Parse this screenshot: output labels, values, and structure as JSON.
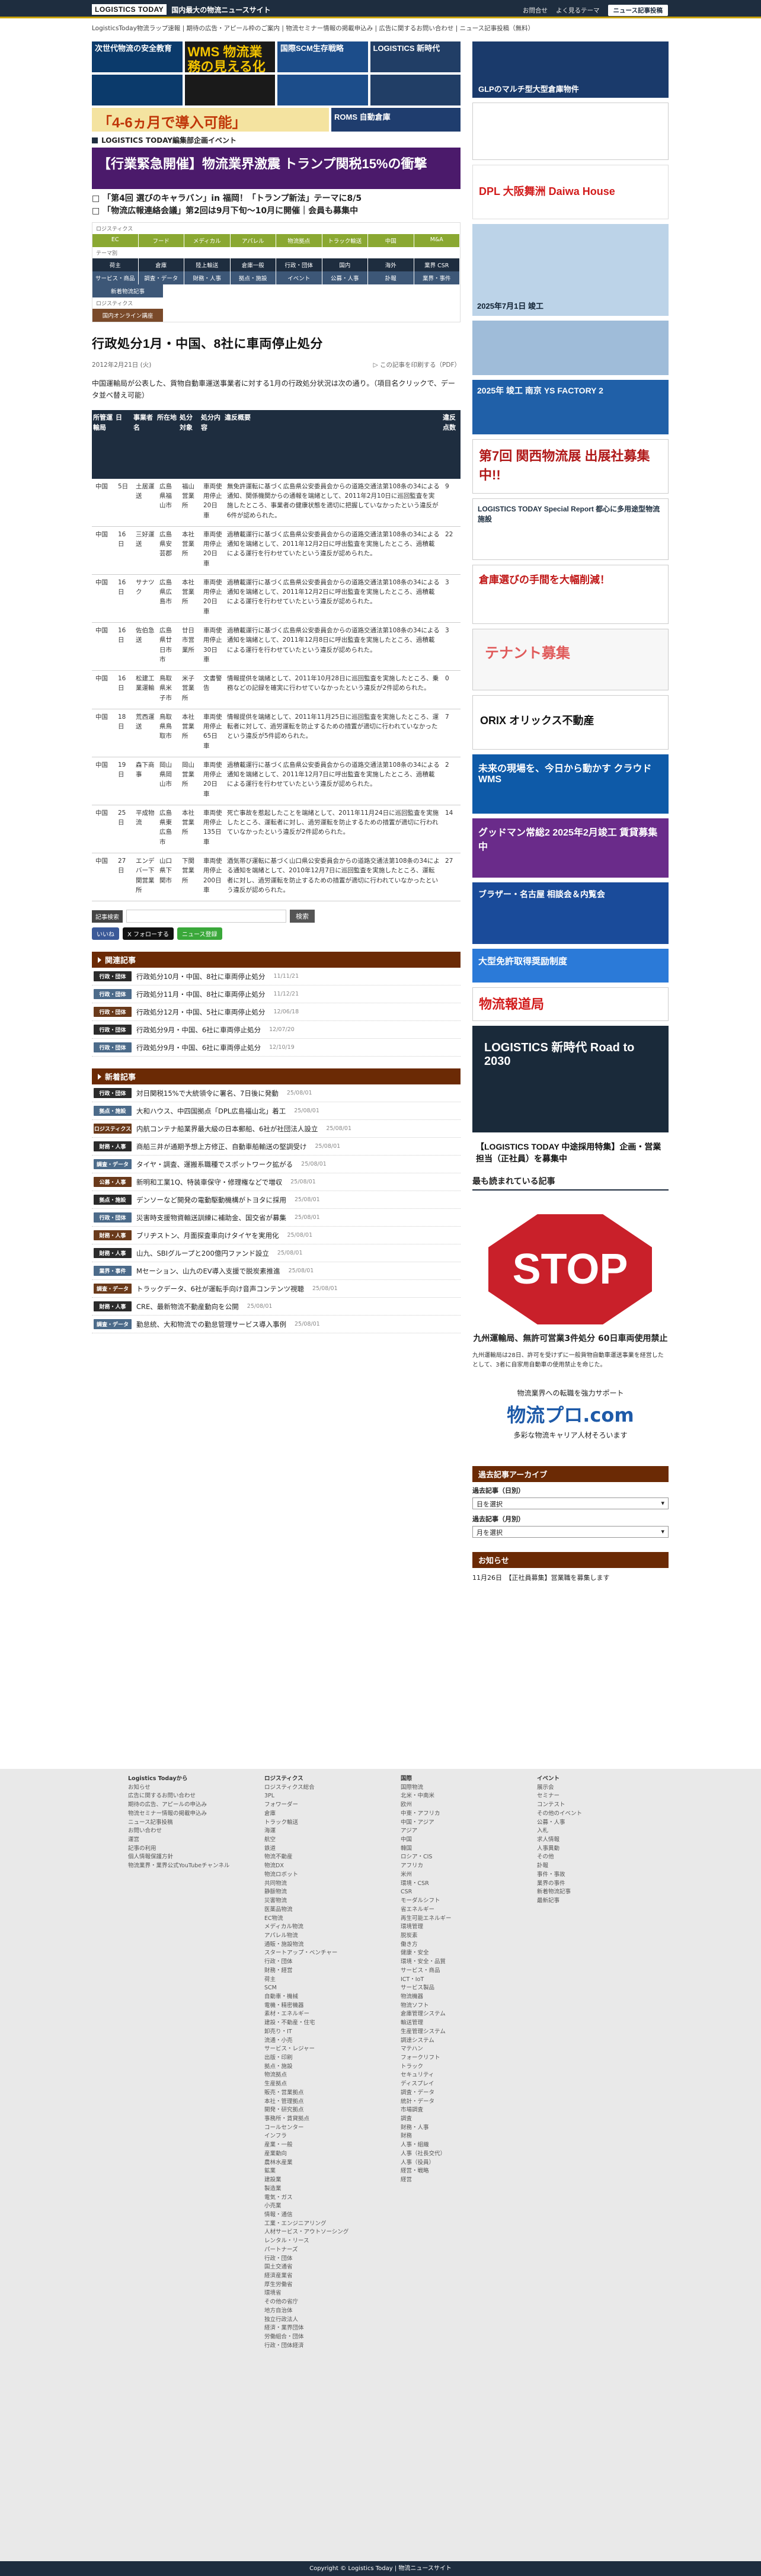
{
  "header": {
    "logo_text": "LOGISTICS TODAY",
    "logo_sub": "国内最大の物流ニュースサイト",
    "links": [
      "お問合せ",
      "よく見るテーマ"
    ],
    "news_btn": "ニュース記事投稿"
  },
  "ticker": "LogisticsToday物流ラップ速報 | 期待の広告・アピール枠のご案内 | 物流セミナー情報の掲載申込み | 広告に関するお問い合わせ | ニュース記事投稿（無料）",
  "banners": {
    "top": [
      "次世代物流の安全教育",
      "WMS 物流業務の見える化",
      "国際SCM生存戦略",
      "LOGISTICS 新時代"
    ],
    "roms": "「4-6ヵ月で導入可能」",
    "rollbar": "ROMS 自動倉庫",
    "event_label": "LOGISTICS TODAY編集部企画イベント",
    "promo": "【行業緊急開催】物流業界激震 トランプ関税15%の衝撃",
    "headlines": [
      "「第4回 選びのキャラバン」in 福岡！「トランプ新法」テーマに8/5",
      "「物流広報連絡会議」第2回は9月下旬〜10月に開催｜会員も募集中"
    ]
  },
  "categories": {
    "head1": "ロジスティクス",
    "row1": [
      "EC",
      "フード",
      "メディカル",
      "アパレル",
      "物流拠点",
      "トラック輸送",
      "中国",
      "M&A"
    ],
    "head2": "テーマ別",
    "row2": [
      "荷主",
      "倉庫",
      "陸上輸送",
      "倉庫一般",
      "行政・団体",
      "国内",
      "海外",
      "業界 CSR"
    ],
    "row3": [
      "サービス・商品",
      "調査・データ",
      "財務・人事",
      "拠点・施設",
      "イベント",
      "公募・人事",
      "訃報",
      "業界・事件"
    ],
    "row4": [
      "新着物流記事"
    ],
    "head3": "ロジスティクス",
    "row5": [
      "国内オンライン講座"
    ]
  },
  "article": {
    "title": "行政処分1月・中国、8社に車両停止処分",
    "date": "2012年2月21日 (火)",
    "print": "この記事を印刷する（PDF）",
    "body": "中国運輸局が公表した、貨物自動車運送事業者に対する1月の行政処分状況は次の通り。（項目名クリックで、データ並べ替え可能）",
    "columns": [
      "所管運輸局",
      "日",
      "事業者名",
      "所在地",
      "処分対象",
      "処分内容",
      "違反概要",
      "違反点数"
    ],
    "rows": [
      {
        "region": "中国",
        "day": "5日",
        "company": "土居運送",
        "location": "広島県福山市",
        "target": "福山営業所",
        "action": "車両使用停止20日車",
        "summary": "無免許運転に基づく広島県公安委員会からの道路交通法第108条の34による通知、関係機関からの通報を端緒として、2011年2月10日に巡回監査を実施したところ、事業者の健康状態を適切に把握していなかったという違反が6件が認められた。",
        "points": "9"
      },
      {
        "region": "中国",
        "day": "16日",
        "company": "三好運送",
        "location": "広島県安芸郡",
        "target": "本社営業所",
        "action": "車両使用停止20日車",
        "summary": "過積載運行に基づく広島県公安委員会からの道路交通法第108条の34による通知を端緒として、2011年12月2日に呼出監査を実施したところ、過積載による運行を行わせていたという違反が認められた。",
        "points": "22"
      },
      {
        "region": "中国",
        "day": "16日",
        "company": "サナツク",
        "location": "広島県広島市",
        "target": "本社営業所",
        "action": "車両使用停止20日車",
        "summary": "過積載運行に基づく広島県公安委員会からの道路交通法第108条の34による通知を端緒として、2011年12月2日に呼出監査を実施したところ、過積載による運行を行わせていたという違反が認められた。",
        "points": "3"
      },
      {
        "region": "中国",
        "day": "16日",
        "company": "佐伯急送",
        "location": "広島県廿日市市",
        "target": "廿日市営業所",
        "action": "車両使用停止30日車",
        "summary": "過積載運行に基づく広島県公安委員会からの道路交通法第108条の34による通知を端緒として、2011年12月8日に呼出監査を実施したところ、過積載による運行を行わせていたという違反が認められた。",
        "points": "3"
      },
      {
        "region": "中国",
        "day": "16日",
        "company": "松建工業運輸",
        "location": "鳥取県米子市",
        "target": "米子営業所",
        "action": "文書警告",
        "summary": "情報提供を端緒として、2011年10月28日に巡回監査を実施したところ、乗務などの記録を確実に行わせていなかったという違反が2件認められた。",
        "points": "0"
      },
      {
        "region": "中国",
        "day": "18日",
        "company": "荒西運送",
        "location": "鳥取県鳥取市",
        "target": "本社営業所",
        "action": "車両使用停止65日車",
        "summary": "情報提供を端緒として、2011年11月25日に巡回監査を実施したところ、運転者に対して、過労運転を防止するための措置が適切に行われていなかったという違反が5件認められた。",
        "points": "7"
      },
      {
        "region": "中国",
        "day": "19日",
        "company": "森下商事",
        "location": "岡山県岡山市",
        "target": "岡山営業所",
        "action": "車両使用停止20日車",
        "summary": "過積載運行に基づく広島県公安委員会からの道路交通法第108条の34による通知を端緒として、2011年12月7日に呼出監査を実施したところ、過積載による運行を行わせていたという違反が認められた。",
        "points": "2"
      },
      {
        "region": "中国",
        "day": "25日",
        "company": "平成物流",
        "location": "広島県東広島市",
        "target": "本社営業所",
        "action": "車両使用停止135日車",
        "summary": "死亡事故を惹起したことを端緒として、2011年11月24日に巡回監査を実施したところ、運転者に対し、過労運転を防止するための措置が適切に行われていなかったという違反が2件認められた。",
        "points": "14"
      },
      {
        "region": "中国",
        "day": "27日",
        "company": "エンデバー下関営業所",
        "location": "山口県下関市",
        "target": "下関営業所",
        "action": "車両使用停止200日車",
        "summary": "酒気帯び運転に基づく山口県公安委員会からの道路交通法第108条の34による通知を端緒として、2010年12月7日に巡回監査を実施したところ、運転者に対し、過労運転を防止するための措置が適切に行われていなかったという違反が認められた。",
        "points": "27"
      }
    ]
  },
  "search": {
    "label": "記事検索",
    "placeholder": "",
    "button": "検索"
  },
  "share": [
    "いいね",
    "X フォローする",
    "ニュース登録"
  ],
  "related": {
    "heading": "関連記事",
    "items": [
      {
        "tag": "行政・団体",
        "title": "行政処分10月・中国、8社に車両停止処分",
        "date": "11/11/21"
      },
      {
        "tag": "行政・団体",
        "title": "行政処分11月・中国、8社に車両停止処分",
        "date": "11/12/21"
      },
      {
        "tag": "行政・団体",
        "title": "行政処分12月・中国、5社に車両停止処分",
        "date": "12/06/18"
      },
      {
        "tag": "行政・団体",
        "title": "行政処分9月・中国、6社に車両停止処分",
        "date": "12/07/20"
      },
      {
        "tag": "行政・団体",
        "title": "行政処分9月・中国、6社に車両停止処分",
        "date": "12/10/19"
      }
    ]
  },
  "latest": {
    "heading": "新着記事",
    "items": [
      {
        "tag": "行政・団体",
        "title": "対日関税15%で大統領令に署名、7日後に発動",
        "date": "25/08/01"
      },
      {
        "tag": "拠点・施設",
        "title": "大和ハウス、中四国拠点「DPL広島福山北」着工",
        "date": "25/08/01"
      },
      {
        "tag": "ロジスティクス",
        "title": "内航コンテナ船業界最大級の日本郵船、6社が社団法人設立",
        "date": "25/08/01"
      },
      {
        "tag": "財務・人事",
        "title": "商船三井が通期予想上方修正、自動車船輸送の堅調受け",
        "date": "25/08/01"
      },
      {
        "tag": "調査・データ",
        "title": "タイヤ・調査、運搬系職種でスポットワーク拡がる",
        "date": "25/08/01"
      },
      {
        "tag": "公募・人事",
        "title": "新明和工業1Q、特装車保守・修理権などで増収",
        "date": "25/08/01"
      },
      {
        "tag": "拠点・施設",
        "title": "デンソーなど開発の電動駆動機構がトヨタに採用",
        "date": "25/08/01"
      },
      {
        "tag": "行政・団体",
        "title": "災害時支援物資輸送訓練に補助金、国交省が募集",
        "date": "25/08/01"
      },
      {
        "tag": "財務・人事",
        "title": "ブリヂストン、月面探査車向けタイヤを実用化",
        "date": "25/08/01"
      },
      {
        "tag": "財務・人事",
        "title": "山九、SBIグループと200億円ファンド設立",
        "date": "25/08/01"
      },
      {
        "tag": "業界・事件",
        "title": "Mセーション、山九のEV導入支援で脱炭素推進",
        "date": "25/08/01"
      },
      {
        "tag": "調査・データ",
        "title": "トラックデータ、6社が運転手向け音声コンテンツ視聴",
        "date": "25/08/01"
      },
      {
        "tag": "財務・人事",
        "title": "CRE、最新物流不動産動向を公開",
        "date": "25/08/01"
      },
      {
        "tag": "調査・データ",
        "title": "勤怠統、大和物流での勤怠管理サービス導入事例",
        "date": "25/08/01"
      }
    ]
  },
  "sidebar": {
    "banners": [
      "GLPのマルチ型大型倉庫物件",
      "DPL 大阪舞洲 Daiwa House",
      "2025年7月1日 竣工",
      "2025年 竣工 南京 YS FACTORY 2",
      "第7回 関西物流展 出展社募集中!!",
      "LOGISTICS TODAY Special Report 都心に多用途型物流施設",
      "倉庫選びの手間を大幅削減！",
      "テナント募集",
      "ORIX オリックス不動産",
      "未来の現場を、今日から動かす クラウドWMS",
      "グッドマン常総2 2025年2月竣工 賃貸募集中",
      "ブラザー・名古屋 相談会＆内覧会",
      "大型免許取得奨励制度",
      "物流報道局",
      "LOGISTICS 新時代 Road to 2030",
      "【LOGISTICS TODAY 中途採用特集】企画・営業担当（正社員）を募集中"
    ],
    "most_read": "最も読まれている記事",
    "stop_text": "STOP",
    "stop_caption": "九州運輸局、無許可営業3件処分 60日車両使用禁止",
    "stop_body": "九州運輸局は28日、許可を受けずに一般貨物自動車運送事業を経営したとして、3者に自家用自動車の使用禁止を命じた。",
    "jobs_text": "物流業界への転職を強力サポート",
    "jobs_brand": "物流プロ.com",
    "jobs_sub": "多彩な物流キャリア人材そろいます",
    "archive": "過去記事アーカイブ",
    "archive_day_label": "過去記事（日別）",
    "archive_day": "日を選択",
    "archive_month_label": "過去記事（月別）",
    "archive_month": "月を選択",
    "notice": "お知らせ",
    "notice_item": "11月26日　【正社員募集】営業職を募集します"
  },
  "footer": {
    "cols": [
      [
        "Logistics Todayから",
        "お知らせ",
        "広告に関するお問い合わせ",
        "期待の広告、アピールの申込み",
        "物流セミナー情報の掲載申込み",
        "ニュース記事投稿",
        "お問い合わせ",
        "運営",
        "記事の利用",
        "個人情報保護方針",
        "物流業界・業界公式YouTubeチャンネル"
      ],
      [
        "ロジスティクス",
        "ロジスティクス総合",
        "3PL",
        "フォワーダー",
        "倉庫",
        "トラック輸送",
        "海運",
        "航空",
        "鉄道",
        "物流不動産",
        "物流DX",
        "物流ロボット",
        "共同物流",
        "静脈物流",
        "災害物流",
        "医薬品物流",
        "EC物流",
        "メディカル物流",
        "アパレル物流",
        "通販・施設物流",
        "スタートアップ・ベンチャー",
        "行政・団体",
        "財務・経営",
        "荷主",
        "SCM",
        "自動車・機械",
        "電機・精密機器",
        "素材・エネルギー",
        "建設・不動産・住宅",
        "卸売り・IT",
        "流通・小売",
        "サービス・レジャー",
        "出版・印刷",
        "拠点・施設",
        "物流拠点",
        "生産拠点",
        "販売・営業拠点",
        "本社・管理拠点",
        "開発・研究拠点",
        "事務所・賃貸拠点",
        "コールセンター",
        "インフラ",
        "産業・一般",
        "産業動向",
        "農林水産業",
        "鉱業",
        "建設業",
        "製造業",
        "電気・ガス",
        "小売業",
        "情報・通信",
        "工業・エンジニアリング",
        "人材サービス・アウトソーシング",
        "レンタル・リース",
        "パートナーズ",
        "行政・団体",
        "国土交通省",
        "経済産業省",
        "厚生労働省",
        "環境省",
        "その他の省庁",
        "地方自治体",
        "独立行政法人",
        "経済・業界団体",
        "労働組合・団体",
        "行政・団体経済"
      ],
      [
        "国際",
        "国際物流",
        "北米・中南米",
        "欧州",
        "中東・アフリカ",
        "中国・アジア",
        "アジア",
        "中国",
        "韓国",
        "ロシア・CIS",
        "アフリカ",
        "米州",
        "環境・CSR",
        "CSR",
        "モーダルシフト",
        "省エネルギー",
        "再生可能エネルギー",
        "環境管理",
        "脱炭素",
        "働き方",
        "健康・安全",
        "環境・安全・品質",
        "サービス・商品",
        "ICT・IoT",
        "サービス製品",
        "物流機器",
        "物流ソフト",
        "倉庫管理システム",
        "輸送管理",
        "生産管理システム",
        "調達システム",
        "マテハン",
        "フォークリフト",
        "トラック",
        "セキュリティ",
        "ディスプレイ",
        "調査・データ",
        "統計・データ",
        "市場調査",
        "調査",
        "財務・人事",
        "財務",
        "人事・組織",
        "人事（社長交代）",
        "人事（役員）",
        "経営・戦略",
        "経営"
      ],
      [
        "イベント",
        "展示会",
        "セミナー",
        "コンテスト",
        "その他のイベント",
        "公募・人事",
        "入札",
        "求人情報",
        "人事異動",
        "その他",
        "訃報",
        "事件・事故",
        "業界の事件",
        "新着物流記事",
        "最新記事"
      ]
    ],
    "copyright": "Copyright © Logistics Today | 物流ニュースサイト"
  },
  "colors": {
    "navy": "#1e2d3f",
    "gold": "#c8a200",
    "brown": "#6b2a05",
    "daiwa_red": "#d21b1b"
  }
}
